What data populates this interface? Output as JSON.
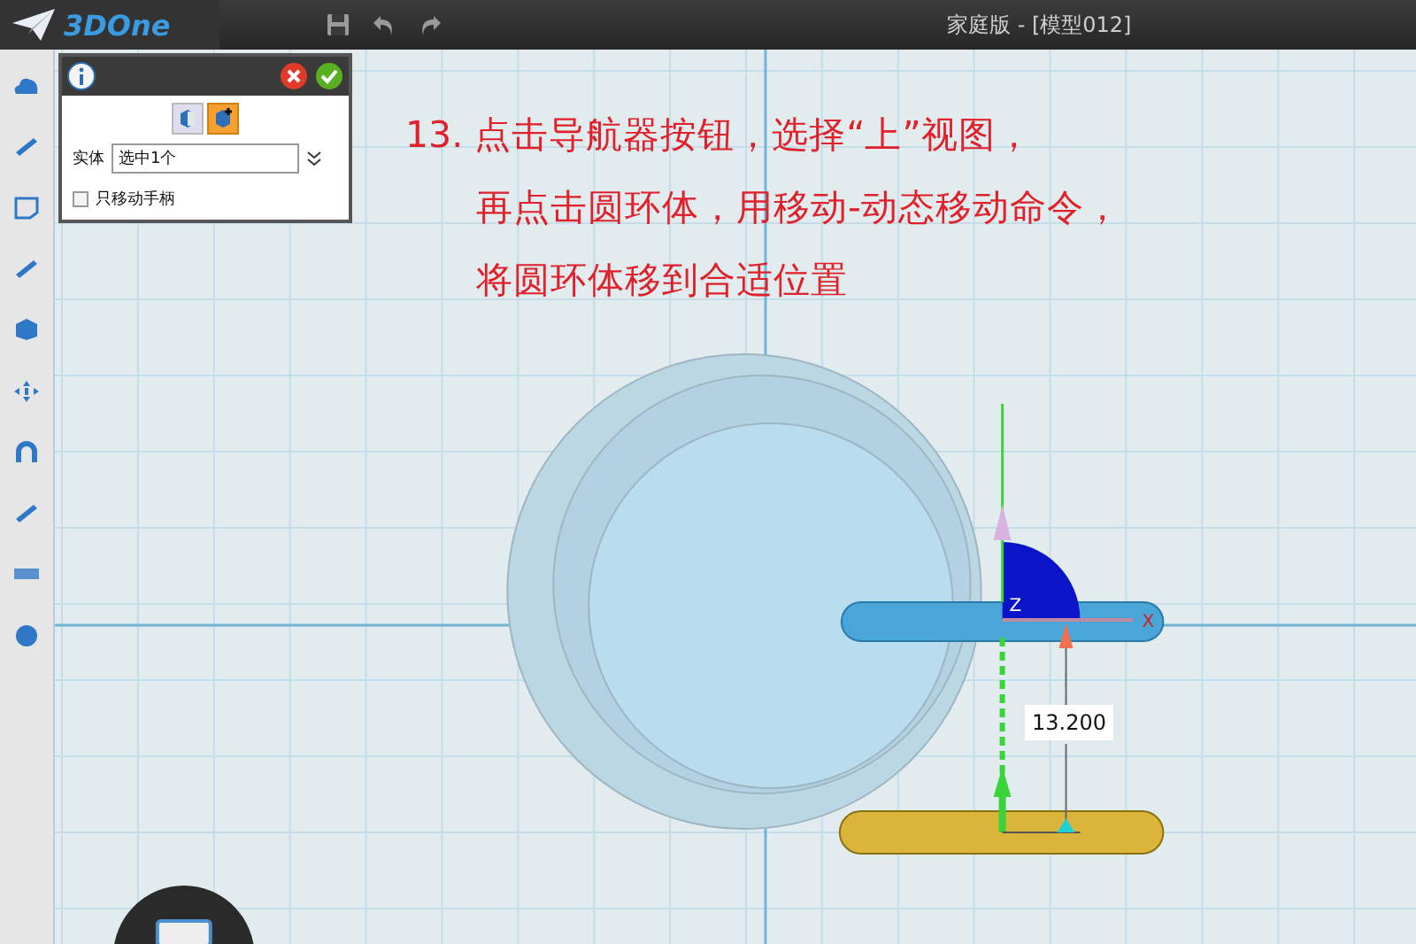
{
  "app": {
    "logo": "3DOne",
    "title": "家庭版 - [模型012]"
  },
  "panel": {
    "modes": [
      {
        "selected": false
      },
      {
        "selected": true
      }
    ],
    "entity_label": "实体",
    "entity_value": "选中1个",
    "handle_only": {
      "label": "只移动手柄",
      "checked": false
    }
  },
  "instructions": [
    "13. 点击导航器按钮，选择“上”视图，",
    "再点击圆环体，用移动-动态移动命令，",
    "将圆环体移到合适位置"
  ],
  "gizmo": {
    "axis_z": "Z",
    "axis_x": "X",
    "distance": "13.200"
  }
}
